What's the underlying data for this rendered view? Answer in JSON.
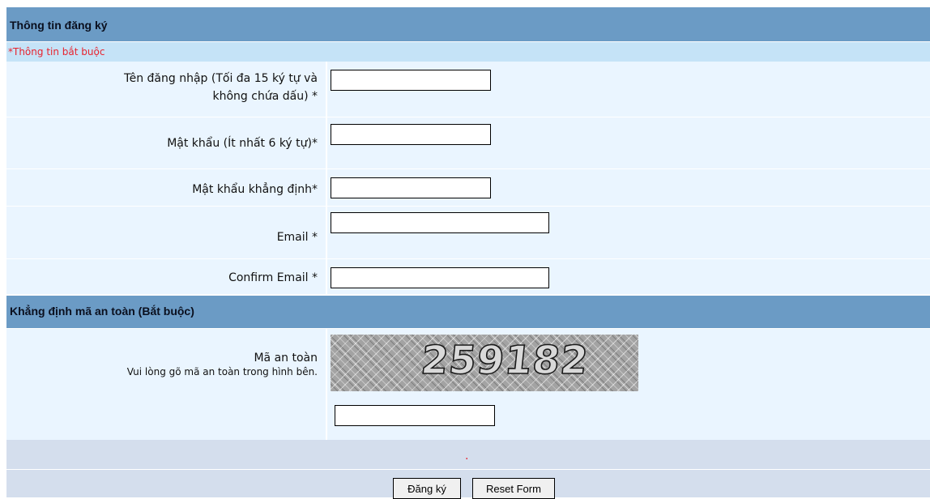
{
  "section_registration": {
    "title": "Thông tin đăng ký",
    "required_note": "*Thông tin bắt buộc"
  },
  "fields": {
    "username": {
      "label_line1": "Tên đăng nhập (Tối đa 15 ký tự và",
      "label_line2": "không chứa dấu) *",
      "value": ""
    },
    "password": {
      "label": "Mật khẩu (Ít nhất 6 ký tự)*",
      "value": ""
    },
    "password_confirm": {
      "label": "Mật khẩu khẳng định*",
      "value": ""
    },
    "email": {
      "label": "Email *",
      "value": ""
    },
    "email_confirm": {
      "label": "Confirm Email *",
      "value": ""
    }
  },
  "section_security": {
    "title": "Khẳng định mã an toàn (Bắt buộc)",
    "code_label": "Mã an toàn",
    "code_hint": "Vui lòng gõ mã an toàn trong hình bên.",
    "captcha_text": "259182",
    "code_value": ""
  },
  "footer": {
    "status_mark": "."
  },
  "buttons": {
    "submit_label": "Đăng ký",
    "reset_label": "Reset Form"
  },
  "colors": {
    "header_bg": "#6b9bc5",
    "required_bar_bg": "#c5e3f7",
    "required_text": "#e8232e",
    "row_bg": "#eaf5ff",
    "footer_bg": "#d4deed"
  }
}
